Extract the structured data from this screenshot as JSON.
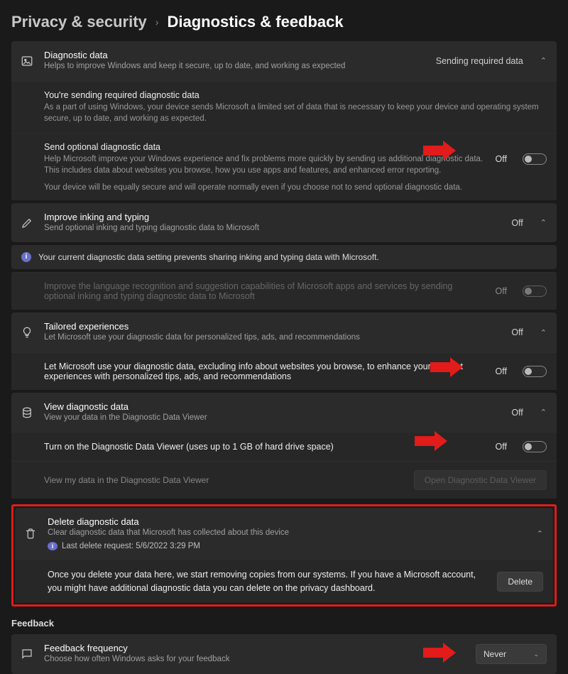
{
  "breadcrumb": {
    "parent": "Privacy & security",
    "current": "Diagnostics & feedback"
  },
  "diag": {
    "title": "Diagnostic data",
    "subtitle": "Helps to improve Windows and keep it secure, up to date, and working as expected",
    "status": "Sending required data",
    "required_title": "You're sending required diagnostic data",
    "required_desc": "As a part of using Windows, your device sends Microsoft a limited set of data that is necessary to keep your device and operating system secure, up to date, and working as expected.",
    "optional_title": "Send optional diagnostic data",
    "optional_desc": "Help Microsoft improve your Windows experience and fix problems more quickly by sending us additional diagnostic data. This includes data about websites you browse, how you use apps and features, and enhanced error reporting.",
    "optional_note": "Your device will be equally secure and will operate normally even if you choose not to send optional diagnostic data.",
    "optional_state": "Off"
  },
  "inking": {
    "title": "Improve inking and typing",
    "subtitle": "Send optional inking and typing diagnostic data to Microsoft",
    "state": "Off",
    "info": "Your current diagnostic data setting prevents sharing inking and typing data with Microsoft.",
    "sub_desc": "Improve the language recognition and suggestion capabilities of Microsoft apps and services by sending optional inking and typing diagnostic data to Microsoft",
    "sub_state": "Off"
  },
  "tailored": {
    "title": "Tailored experiences",
    "subtitle": "Let Microsoft use your diagnostic data for personalized tips, ads, and recommendations",
    "state": "Off",
    "sub_desc": "Let Microsoft use your diagnostic data, excluding info about websites you browse, to enhance your product experiences with personalized tips, ads, and recommendations",
    "sub_state": "Off"
  },
  "view": {
    "title": "View diagnostic data",
    "subtitle": "View your data in the Diagnostic Data Viewer",
    "state": "Off",
    "sub_desc": "Turn on the Diagnostic Data Viewer (uses up to 1 GB of hard drive space)",
    "sub_state": "Off",
    "link": "View my data in the Diagnostic Data Viewer",
    "button": "Open Diagnostic Data Viewer"
  },
  "delete": {
    "title": "Delete diagnostic data",
    "subtitle": "Clear diagnostic data that Microsoft has collected about this device",
    "last_label": "Last delete request: 5/6/2022 3:29 PM",
    "desc": "Once you delete your data here, we start removing copies from our systems. If you have a Microsoft account, you might have additional diagnostic data you can delete on the privacy dashboard.",
    "button": "Delete"
  },
  "feedback": {
    "section": "Feedback",
    "title": "Feedback frequency",
    "subtitle": "Choose how often Windows asks for your feedback",
    "value": "Never"
  }
}
